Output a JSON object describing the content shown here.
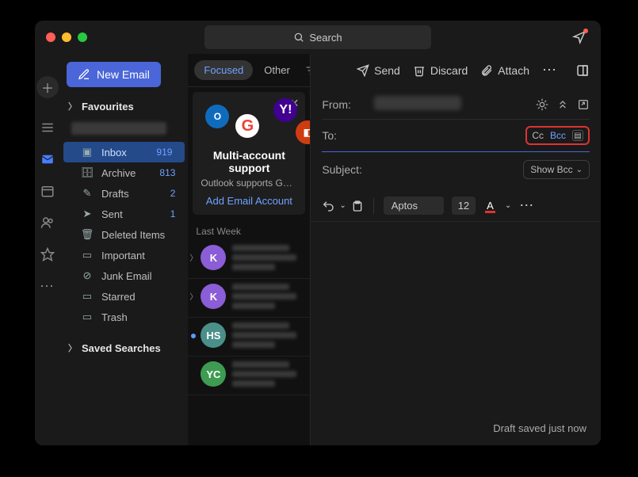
{
  "titlebar": {
    "search_placeholder": "Search"
  },
  "sidebar": {
    "new_email_label": "New Email",
    "sections": {
      "favourites": "Favourites",
      "saved_searches": "Saved Searches"
    },
    "folders": [
      {
        "name": "Inbox",
        "count": "919",
        "icon": "inbox-icon",
        "active": true
      },
      {
        "name": "Archive",
        "count": "813",
        "icon": "archive-icon"
      },
      {
        "name": "Drafts",
        "count": "2",
        "icon": "drafts-icon"
      },
      {
        "name": "Sent",
        "count": "1",
        "icon": "sent-icon"
      },
      {
        "name": "Deleted Items",
        "count": "",
        "icon": "trash-icon"
      },
      {
        "name": "Important",
        "count": "",
        "icon": "folder-icon"
      },
      {
        "name": "Junk Email",
        "count": "",
        "icon": "junk-icon"
      },
      {
        "name": "Starred",
        "count": "",
        "icon": "folder-icon"
      },
      {
        "name": "Trash",
        "count": "",
        "icon": "folder-icon"
      }
    ]
  },
  "msglist": {
    "tab_focused": "Focused",
    "tab_other": "Other",
    "promo": {
      "title": "Multi-account support",
      "subtitle": "Outlook supports Gmail, Yahoo an…",
      "link": "Add Email Account"
    },
    "section_lastweek": "Last Week",
    "avatars": [
      "K",
      "K",
      "HS",
      "YC"
    ],
    "avatar_colors": [
      "#8b5dd6",
      "#8b5dd6",
      "#4a8f8a",
      "#3d9c52"
    ]
  },
  "compose": {
    "actions": {
      "send": "Send",
      "discard": "Discard",
      "attach": "Attach"
    },
    "fields": {
      "from_label": "From:",
      "to_label": "To:",
      "subject_label": "Subject:"
    },
    "cc_label": "Cc",
    "bcc_label": "Bcc",
    "show_bcc_label": "Show Bcc",
    "font_name": "Aptos",
    "font_size": "12",
    "draft_status": "Draft saved just now"
  }
}
